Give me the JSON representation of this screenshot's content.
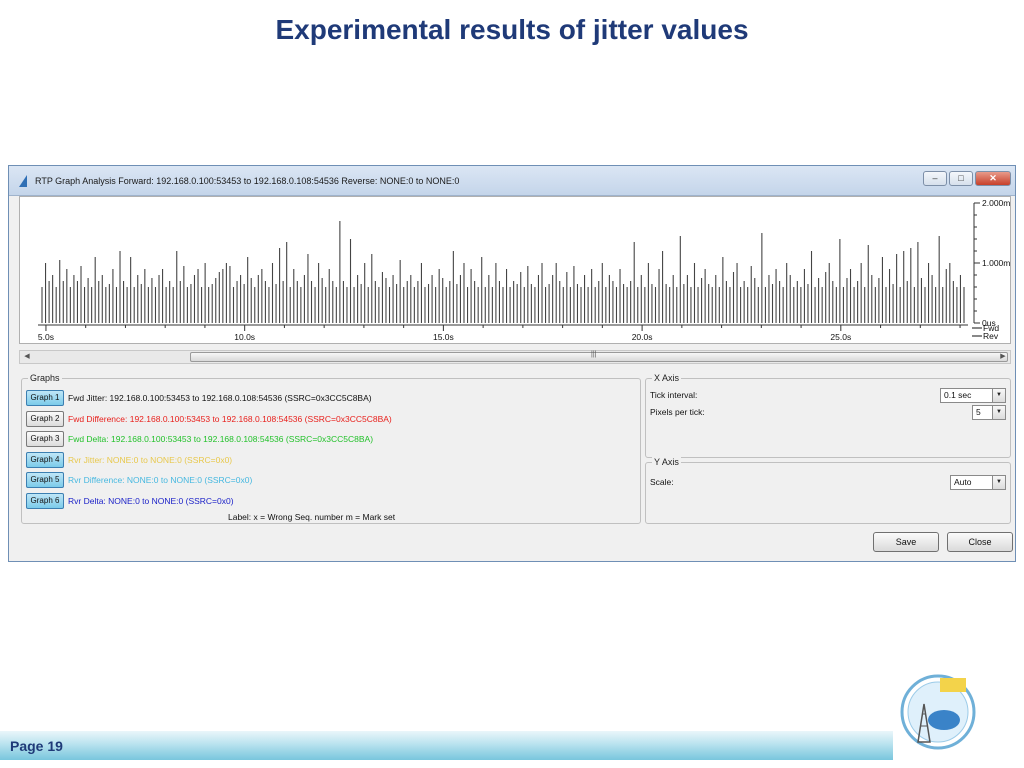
{
  "slide": {
    "title": "Experimental results of jitter values",
    "page_label": "Page 19"
  },
  "window": {
    "title": "RTP Graph Analysis Forward: 192.168.0.100:53453 to 192.168.0.108:54536   Reverse: NONE:0 to NONE:0",
    "buttons": {
      "minimize": "–",
      "maximize": "□",
      "close": "✕"
    }
  },
  "chart_data": {
    "type": "bar",
    "x_ticks": [
      "5.0s",
      "10.0s",
      "15.0s",
      "20.0s",
      "25.0s"
    ],
    "x_tick_values": [
      5,
      10,
      15,
      20,
      25
    ],
    "xlim": [
      4.8,
      28.2
    ],
    "y_ticks": [
      "2.000ms",
      "1.000ms",
      "0us"
    ],
    "y_tick_values": [
      2,
      1,
      0
    ],
    "ylim": [
      0,
      2
    ],
    "legend_series": [
      "Fwd",
      "Rev"
    ],
    "color": "#444444",
    "series": [
      {
        "values": [
          0.6,
          1.0,
          0.7,
          0.8,
          0.6,
          1.05,
          0.7,
          0.9,
          0.6,
          0.8,
          0.7,
          0.95,
          0.6,
          0.75,
          0.6,
          1.1,
          0.7,
          0.8,
          0.6,
          0.65,
          0.9,
          0.6,
          1.2,
          0.7,
          0.6,
          1.1,
          0.6,
          0.8,
          0.65,
          0.9,
          0.6,
          0.75,
          0.6,
          0.8,
          0.9,
          0.6,
          0.7,
          0.6,
          1.2,
          0.7,
          0.95,
          0.6,
          0.65,
          0.8,
          0.9,
          0.6,
          1.0,
          0.6,
          0.65,
          0.75,
          0.85,
          0.9,
          1.0,
          0.95,
          0.6,
          0.7,
          0.8,
          0.65,
          1.1,
          0.75,
          0.6,
          0.8,
          0.9,
          0.7,
          0.6,
          1.0,
          0.65,
          1.25,
          0.7,
          1.35,
          0.6,
          0.9,
          0.7,
          0.6,
          0.8,
          1.15,
          0.7,
          0.6,
          1.0,
          0.75,
          0.6,
          0.9,
          0.7,
          0.6,
          1.7,
          0.7,
          0.6,
          1.4,
          0.6,
          0.8,
          0.65,
          1.0,
          0.6,
          1.15,
          0.7,
          0.6,
          0.85,
          0.75,
          0.6,
          0.8,
          0.65,
          1.05,
          0.6,
          0.7,
          0.8,
          0.6,
          0.7,
          1.0,
          0.6,
          0.65,
          0.8,
          0.6,
          0.9,
          0.75,
          0.6,
          0.7,
          1.2,
          0.65,
          0.8,
          1.0,
          0.6,
          0.9,
          0.7,
          0.6,
          1.1,
          0.6,
          0.8,
          0.6,
          1.0,
          0.7,
          0.6,
          0.9,
          0.6,
          0.7,
          0.65,
          0.85,
          0.6,
          0.95,
          0.65,
          0.6,
          0.8,
          1.0,
          0.6,
          0.65,
          0.8,
          1.0,
          0.7,
          0.6,
          0.85,
          0.6,
          0.95,
          0.65,
          0.6,
          0.8,
          0.6,
          0.9,
          0.6,
          0.7,
          1.0,
          0.6,
          0.8,
          0.7,
          0.6,
          0.9,
          0.65,
          0.6,
          0.7,
          1.35,
          0.6,
          0.8,
          0.6,
          1.0,
          0.65,
          0.6,
          0.9,
          1.2,
          0.65,
          0.6,
          0.8,
          0.6,
          1.45,
          0.65,
          0.8,
          0.6,
          1.0,
          0.6,
          0.75,
          0.9,
          0.65,
          0.6,
          0.8,
          0.6,
          1.1,
          0.7,
          0.6,
          0.85,
          1.0,
          0.6,
          0.7,
          0.6,
          0.95,
          0.75,
          0.6,
          1.5,
          0.6,
          0.8,
          0.65,
          0.9,
          0.7,
          0.6,
          1.0,
          0.8,
          0.6,
          0.7,
          0.6,
          0.9,
          0.65,
          1.2,
          0.6,
          0.75,
          0.6,
          0.85,
          1.0,
          0.7,
          0.6,
          1.4,
          0.6,
          0.75,
          0.9,
          0.6,
          0.7,
          1.0,
          0.6,
          1.3,
          0.8,
          0.6,
          0.75,
          1.1,
          0.6,
          0.9,
          0.65,
          1.15,
          0.6,
          1.2,
          0.7,
          1.25,
          0.6,
          1.35,
          0.75,
          0.6,
          1.0,
          0.8,
          0.6,
          1.45,
          0.6,
          0.9,
          1.0,
          0.7,
          0.6,
          0.8,
          0.6
        ]
      }
    ]
  },
  "graphs": {
    "legend": "Graphs",
    "items": [
      {
        "button": "Graph 1",
        "label": "Fwd Jitter: 192.168.0.100:53453 to 192.168.0.108:54536 (SSRC=0x3CC5C8BA)",
        "color": "#111111",
        "active": true
      },
      {
        "button": "Graph 2",
        "label": "Fwd Difference: 192.168.0.100:53453 to 192.168.0.108:54536 (SSRC=0x3CC5C8BA)",
        "color": "#e8201c",
        "active": false
      },
      {
        "button": "Graph 3",
        "label": "Fwd Delta: 192.168.0.100:53453 to 192.168.0.108:54536 (SSRC=0x3CC5C8BA)",
        "color": "#22c12a",
        "active": false
      },
      {
        "button": "Graph 4",
        "label": "Rvr Jitter: NONE:0 to NONE:0 (SSRC=0x0)",
        "color": "#e8c84c",
        "active": true
      },
      {
        "button": "Graph 5",
        "label": "Rvr Difference: NONE:0 to NONE:0 (SSRC=0x0)",
        "color": "#46b8e0",
        "active": true
      },
      {
        "button": "Graph 6",
        "label": "Rvr Delta: NONE:0 to NONE:0 (SSRC=0x0)",
        "color": "#1c22c8",
        "active": true
      }
    ],
    "note": "Label:   x = Wrong Seq. number      m = Mark set"
  },
  "x_axis": {
    "legend": "X Axis",
    "tick_interval_label": "Tick interval:",
    "tick_interval_value": "0.1 sec",
    "pixels_per_tick_label": "Pixels per tick:",
    "pixels_per_tick_value": "5"
  },
  "y_axis": {
    "legend": "Y Axis",
    "scale_label": "Scale:",
    "scale_value": "Auto"
  },
  "dialog_buttons": {
    "save": "Save",
    "close": "Close"
  }
}
